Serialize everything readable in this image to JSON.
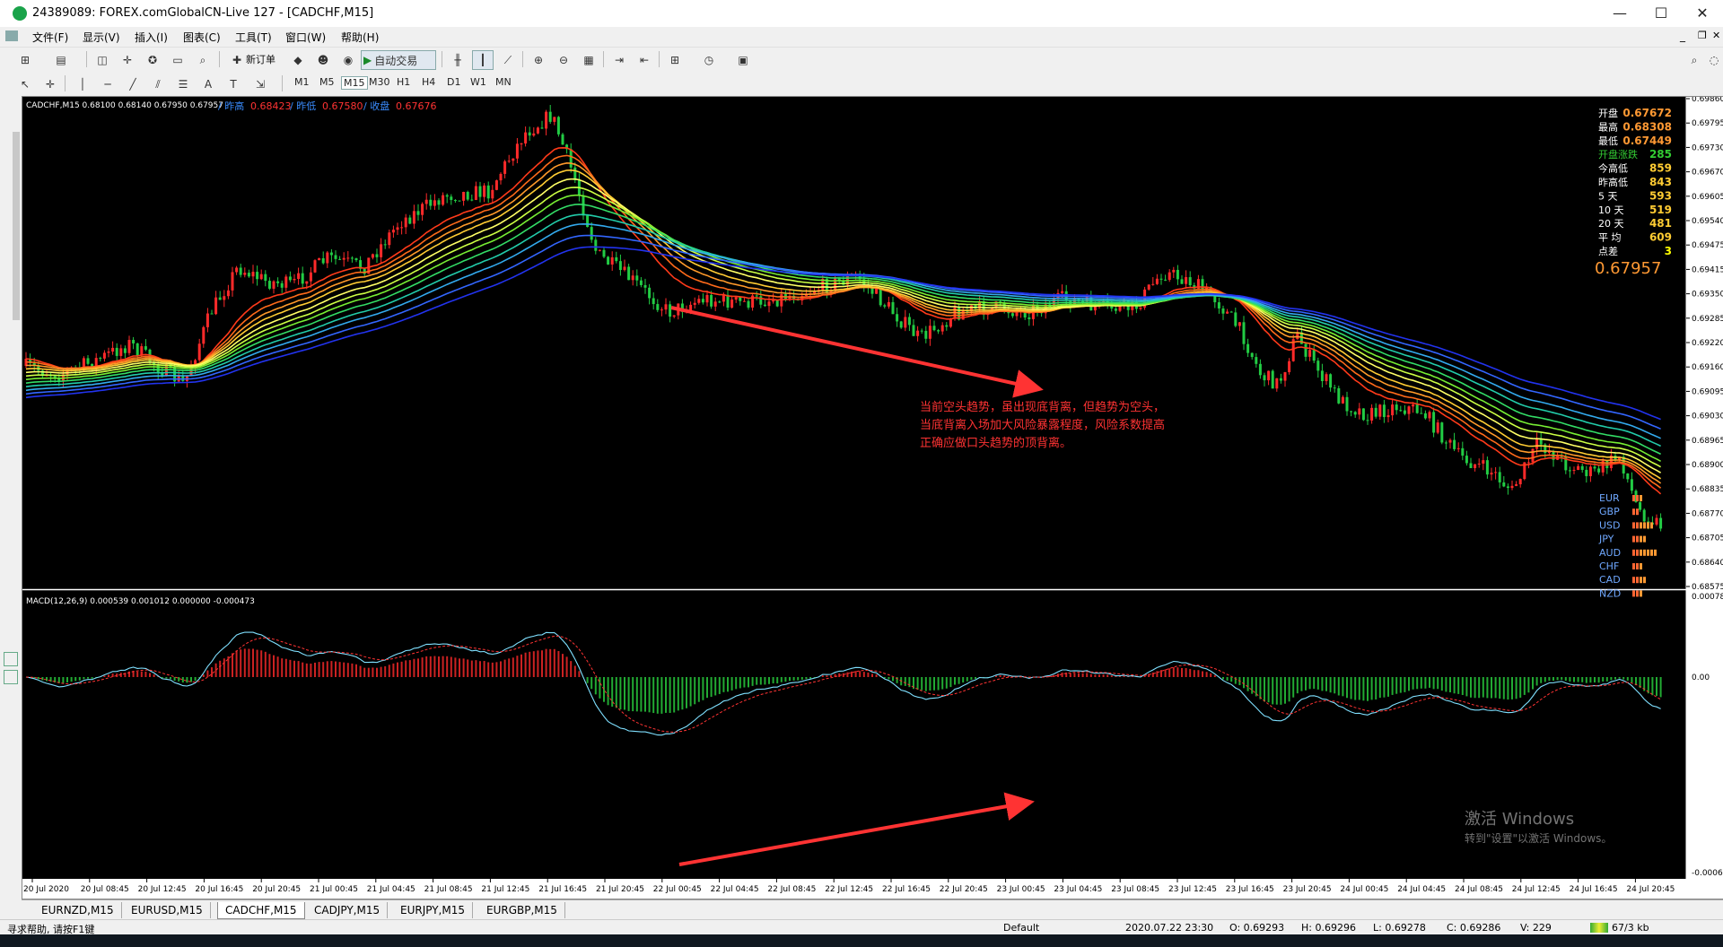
{
  "window": {
    "title": "24389089: FOREX.comGlobalCN-Live 127 - [CADCHF,M15]",
    "minimize": "—",
    "maximize": "☐",
    "close": "✕"
  },
  "menu": [
    "文件(F)",
    "显示(V)",
    "插入(I)",
    "图表(C)",
    "工具(T)",
    "窗口(W)",
    "帮助(H)"
  ],
  "toolbar": {
    "new_order": "新订单",
    "auto_trade": "自动交易",
    "timeframes": [
      "M1",
      "M5",
      "M15",
      "M30",
      "H1",
      "H4",
      "D1",
      "W1",
      "MN"
    ],
    "active_timeframe": "M15",
    "text_tool": "A",
    "label_tool": "T"
  },
  "chart": {
    "header": "CADCHF,M15  0.68100 0.68140 0.67950 0.67957",
    "yesterday": [
      {
        "label": "/ 昨高",
        "value": "0.68423"
      },
      {
        "label": "/ 昨低",
        "value": "0.67580"
      },
      {
        "label": "/ 收盘",
        "value": "0.67676"
      }
    ],
    "info_panel": [
      {
        "label": "开盘",
        "value": "0.67672",
        "color": "#ff9933"
      },
      {
        "label": "最高",
        "value": "0.68308",
        "color": "#ff9933"
      },
      {
        "label": "最低",
        "value": "0.67449",
        "color": "#ff9933"
      },
      {
        "label": "开盘涨跌",
        "value": "285",
        "color": "#33cc33"
      },
      {
        "label": "今高低",
        "value": "859",
        "color": "#ffcc33"
      },
      {
        "label": "昨高低",
        "value": "843",
        "color": "#ffcc33"
      },
      {
        "label": "5   天",
        "value": "593",
        "color": "#ffcc33"
      },
      {
        "label": "10  天",
        "value": "519",
        "color": "#ffcc33"
      },
      {
        "label": "20  天",
        "value": "481",
        "color": "#ffcc33"
      },
      {
        "label": "平   均",
        "value": "609",
        "color": "#ffcc33"
      },
      {
        "label": "点差",
        "value": "3",
        "color": "#ffff00"
      }
    ],
    "current_price": "0.67957",
    "annotation": [
      "当前空头趋势，虽出现底背离，但趋势为空头，",
      "当底背离入场加大风险暴露程度，风险系数提高",
      "正确应做口头趋势的顶背离。"
    ],
    "currencies": [
      "EUR",
      "GBP",
      "USD",
      "JPY",
      "AUD",
      "CHF",
      "CAD",
      "NZD"
    ],
    "price_axis": [
      "0.69860",
      "0.69795",
      "0.69730",
      "0.69670",
      "0.69605",
      "0.69540",
      "0.69475",
      "0.69415",
      "0.69350",
      "0.69285",
      "0.69220",
      "0.69160",
      "0.69095",
      "0.69030",
      "0.68965",
      "0.68900",
      "0.68835",
      "0.68770",
      "0.68705",
      "0.68640",
      "0.68575"
    ],
    "macd_header": "MACD(12,26,9) 0.000539 0.001012 0.000000 -0.000473",
    "macd_axis": [
      "0.00078",
      "0.00",
      "-0.00067"
    ],
    "time_axis": [
      "20 Jul 2020",
      "20 Jul 08:45",
      "20 Jul 12:45",
      "20 Jul 16:45",
      "20 Jul 20:45",
      "21 Jul 00:45",
      "21 Jul 04:45",
      "21 Jul 08:45",
      "21 Jul 12:45",
      "21 Jul 16:45",
      "21 Jul 20:45",
      "22 Jul 00:45",
      "22 Jul 04:45",
      "22 Jul 08:45",
      "22 Jul 12:45",
      "22 Jul 16:45",
      "22 Jul 20:45",
      "23 Jul 00:45",
      "23 Jul 04:45",
      "23 Jul 08:45",
      "23 Jul 12:45",
      "23 Jul 16:45",
      "23 Jul 20:45",
      "24 Jul 00:45",
      "24 Jul 04:45",
      "24 Jul 08:45",
      "24 Jul 12:45",
      "24 Jul 16:45",
      "24 Jul 20:45"
    ],
    "watermark": [
      "激活 Windows",
      "转到\"设置\"以激活 Windows。"
    ]
  },
  "tabs": [
    "EURNZD,M15",
    "EURUSD,M15",
    "CADCHF,M15",
    "CADJPY,M15",
    "EURJPY,M15",
    "EURGBP,M15"
  ],
  "active_tab": "CADCHF,M15",
  "status": {
    "help": "寻求帮助, 请按F1键",
    "profile": "Default",
    "time": "2020.07.22 23:30",
    "open": "O: 0.69293",
    "high": "H: 0.69296",
    "low": "L: 0.69278",
    "close": "C: 0.69286",
    "volume": "V: 229",
    "traffic": "67/3 kb"
  },
  "colors": {
    "bull": "#ff2a2a",
    "bear": "#22cc44",
    "arrow": "#ff3333",
    "annotation": "#ff3333"
  }
}
